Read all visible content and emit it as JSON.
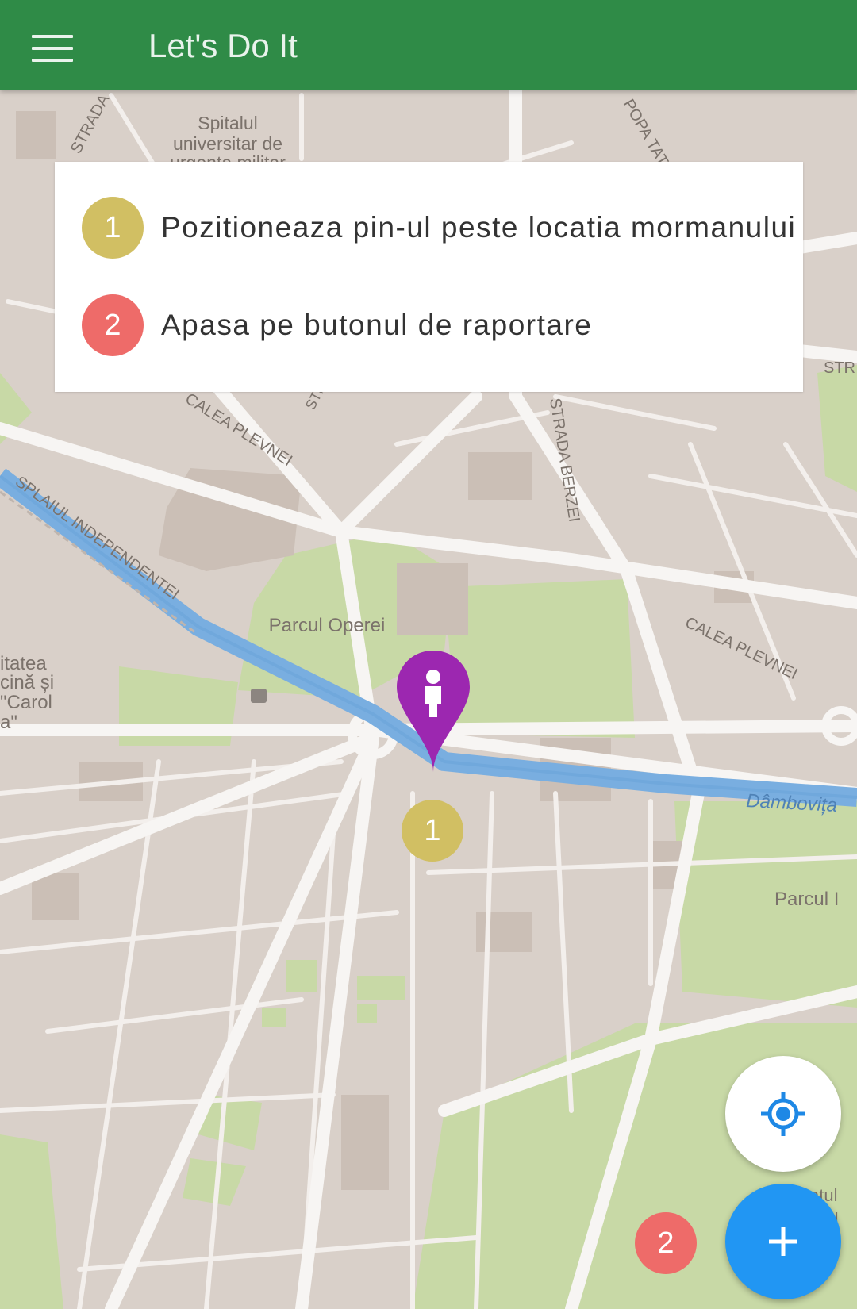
{
  "app": {
    "title": "Let's Do It"
  },
  "colors": {
    "appbar": "#2f8b47",
    "step1": "#d1bf63",
    "step2": "#ee6b69",
    "pin": "#9c27b0",
    "fab_add": "#2196f3",
    "locate_icon": "#1e88e5"
  },
  "instructions": [
    {
      "number": "1",
      "text": "Pozitioneaza pin-ul peste locatia mormanului"
    },
    {
      "number": "2",
      "text": "Apasa pe butonul de raportare"
    }
  ],
  "map": {
    "labels": {
      "spital": "Spitalul",
      "spital2": "universitar de",
      "spital3": "urgenta militar",
      "strada_top": "STRADA",
      "popa": "POPA TAT",
      "str_right": "STR",
      "calea_plevnei_left": "CALEA PLEVNEI",
      "str_small": "STR",
      "splaiul": "SPLAIUL INDEPENDENTEI",
      "berzei": "STRADA BERZEI",
      "calea_plevnei_right": "CALEA PLEVNEI",
      "parcul_operei": "Parcul Operei",
      "univ1": "itatea",
      "univ2": "cină și",
      "univ3": "\"Carol",
      "univ4": "a\"",
      "dambovita": "Dâmbovița",
      "parcul_right": "Parcul I",
      "bottom_right1": "atul",
      "bottom_right2": "ntu"
    },
    "pin_badge": "1",
    "fab_badge": "2"
  },
  "icons": {
    "menu": "hamburger-menu-icon",
    "pin": "person-location-pin-icon",
    "locate": "crosshair-location-icon",
    "add": "plus-icon"
  }
}
